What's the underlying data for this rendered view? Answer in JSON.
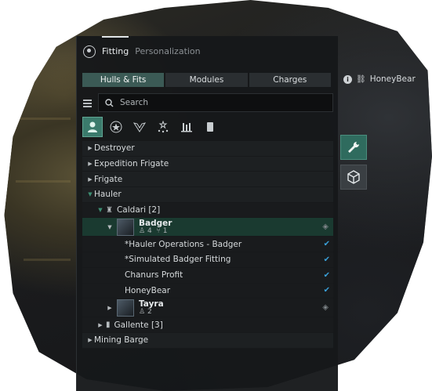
{
  "window": {
    "tabs": [
      "Fitting",
      "Personalization"
    ]
  },
  "segments": [
    "Hulls & Fits",
    "Modules",
    "Charges"
  ],
  "search": {
    "placeholder": "Search"
  },
  "filter_icons": [
    "pilot-icon",
    "star-icon",
    "wings-icon",
    "stars-icon",
    "skill-icon",
    "card-icon"
  ],
  "tree": {
    "groups": [
      {
        "label": "Destroyer"
      },
      {
        "label": "Expedition Frigate"
      },
      {
        "label": "Frigate"
      },
      {
        "label": "Hauler"
      }
    ],
    "caldari": "Caldari  [2]",
    "badger": {
      "name": "Badger",
      "skills": "4",
      "fits": "1"
    },
    "fits": [
      "*Hauler Operations - Badger",
      "*Simulated Badger Fitting",
      "Chanurs Profit",
      "HoneyBear"
    ],
    "tayra": {
      "name": "Tayra",
      "skills": "2"
    },
    "gallente": "Gallente  [3]",
    "mining": "Mining Barge"
  },
  "right_panel": {
    "title": "HoneyBear"
  },
  "colors": {
    "accent": "#3b7b6c",
    "check": "#3aa0d8",
    "selected_row": "#1a3a30"
  }
}
